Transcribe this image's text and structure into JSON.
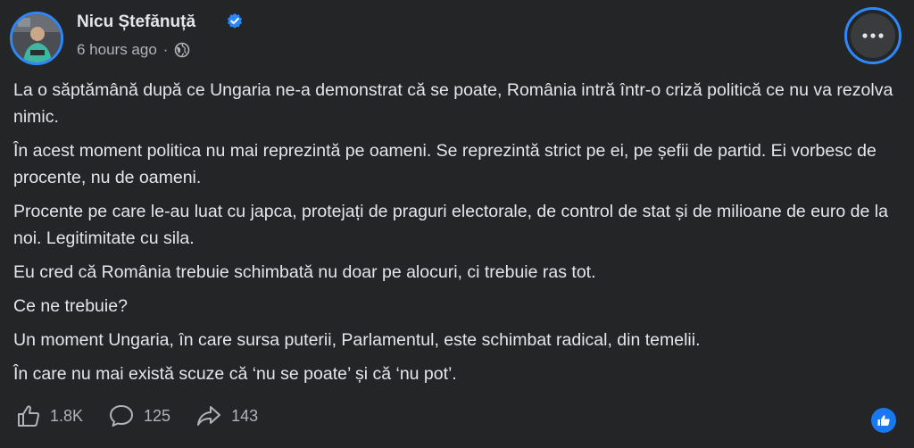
{
  "post": {
    "author": "Nicu Ștefănuță",
    "time": "6 hours ago",
    "separator": "·",
    "paragraphs": [
      "La o săptămână după ce Ungaria ne-a demonstrat că se poate, România intră într-o criză politică ce nu va rezolva nimic.",
      "În acest moment politica nu mai reprezintă pe oameni. Se reprezintă strict pe ei, pe șefii de partid. Ei vorbesc de procente, nu de oameni.",
      "Procente pe care le-au luat cu japca, protejați de praguri electorale, de control de stat și de milioane de euro de la noi. Legitimitate cu sila.",
      "Eu cred că România trebuie schimbată nu doar pe alocuri, ci trebuie ras tot.",
      "Ce ne trebuie?",
      "Un moment Ungaria, în care sursa puterii, Parlamentul, este schimbat radical, din temelii.",
      "În care nu mai există scuze că ‘nu se poate’ și că ‘nu pot’."
    ]
  },
  "actions": {
    "likes": "1.8K",
    "comments": "125",
    "shares": "143"
  },
  "colors": {
    "background": "#242526",
    "accent": "#2d88ff",
    "text": "#e4e6eb",
    "muted": "#b0b3b8"
  },
  "icons": {
    "verified": "verified-badge-icon",
    "audience": "globe-icon",
    "more": "more-options-icon",
    "like": "thumbs-up-icon",
    "comment": "comment-icon",
    "share": "share-icon"
  }
}
